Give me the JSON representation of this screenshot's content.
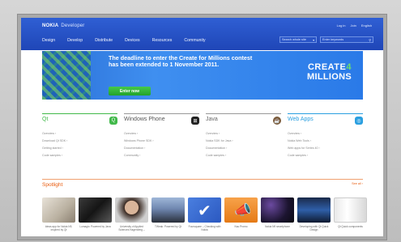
{
  "brand": {
    "name": "NOKIA",
    "suffix": "Developer"
  },
  "header_links": [
    "Log in",
    "Join",
    "English"
  ],
  "nav": [
    "Design",
    "Develop",
    "Distribute",
    "Devices",
    "Resources",
    "Community"
  ],
  "search": {
    "scope": "Search whole site",
    "placeholder": "Enter keywords"
  },
  "banner": {
    "headline_line1": "The deadline to enter the Create for Millions contest",
    "headline_line2": "has been extended to 1 November 2011.",
    "button": "Enter now",
    "logo_line1_a": "CREATE",
    "logo_line1_b": "4",
    "logo_line2": "MILLIONS"
  },
  "categories": [
    {
      "title": "Qt",
      "icon": "qt-icon",
      "color": "#41b94a",
      "links": [
        "Overview ›",
        "Download Qt SDK ›",
        "Getting started ›",
        "Code samples ›"
      ]
    },
    {
      "title": "Windows Phone",
      "icon": "windows-phone-icon",
      "color": "#222222",
      "links": [
        "Overview ›",
        "Windows Phone SDK ›",
        "Documentation ›",
        "Community ›"
      ]
    },
    {
      "title": "Java",
      "icon": "java-icon",
      "color": "#7a5a3a",
      "links": [
        "Overview ›",
        "Nokia SDK for Java ›",
        "Documentation ›",
        "Code samples ›"
      ]
    },
    {
      "title": "Web Apps",
      "icon": "web-apps-icon",
      "color": "#2a9fe0",
      "links": [
        "Overview ›",
        "Nokia Web Tools ›",
        "Web apps for Series 40 ›",
        "Code samples ›"
      ]
    }
  ],
  "spotlight": {
    "title": "Spotlight",
    "see_all": "See all ›",
    "items": [
      {
        "caption": "Ideas app for Nokia N9, inspired by Qt"
      },
      {
        "caption": "Lumagic: Powered by Java"
      },
      {
        "caption": "University of Applied Sciences Hagenberg – Developing for Nokia"
      },
      {
        "caption": "TWeak: Powered by Qt"
      },
      {
        "caption": "Foursquare – Checking with Nokia"
      },
      {
        "caption": "Nuu Promo"
      },
      {
        "caption": "Nokia N9 smartphone"
      },
      {
        "caption": "Developing with Qt Quick Design"
      },
      {
        "caption": "Qt Quick components"
      }
    ]
  }
}
